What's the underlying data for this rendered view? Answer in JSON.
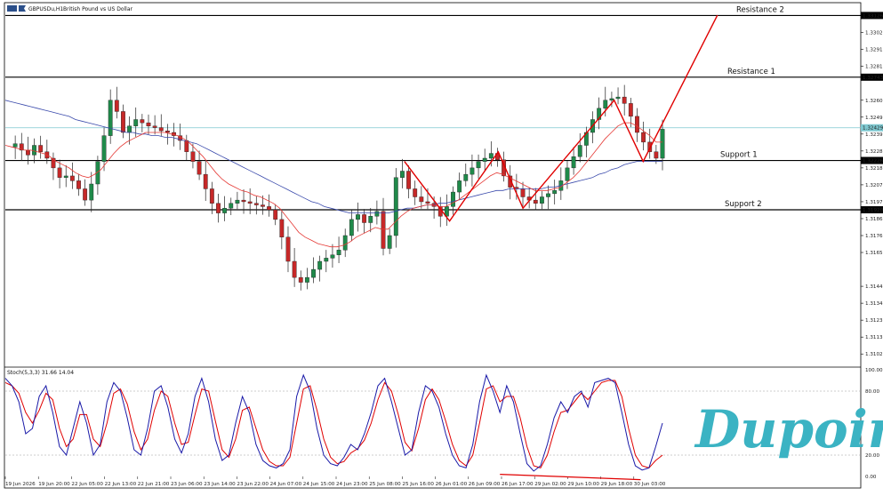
{
  "header": {
    "symbol": "GBPUSDu,H1",
    "description": "British Pound vs US Dollar",
    "icons": [
      "chart-menu-icon",
      "favorite-flag-icon"
    ]
  },
  "colors": {
    "bull": "#2e8b57",
    "bear": "#b22222",
    "ma_fast": "#e53935",
    "ma_slow": "#3949ab",
    "stoch_main": "#1a1aa8",
    "stoch_signal": "#e00000",
    "annotation": "#e00000",
    "current_price_line": "#7ec8d0",
    "logo": "#3bb3c3"
  },
  "levels": [
    {
      "name": "Resistance 2",
      "price": 1.33126,
      "tag": "1.33126"
    },
    {
      "name": "Resistance 1",
      "price": 1.32743,
      "tag": "1.32743"
    },
    {
      "name": "Support 1",
      "price": 1.32226,
      "tag": "1.32226"
    },
    {
      "name": "Support 2",
      "price": 1.3192,
      "tag": "1.31920"
    }
  ],
  "current_price": {
    "price": 1.32429,
    "tag": "1.32429"
  },
  "chart_data": {
    "type": "candlestick",
    "price_axis": {
      "ylim": [
        1.3096,
        1.332
      ],
      "ticks": [
        "1.33020",
        "1.32915",
        "1.32810",
        "1.32600",
        "1.32495",
        "1.32390",
        "1.32285",
        "1.32180",
        "1.32075",
        "1.31970",
        "1.31865",
        "1.31760",
        "1.31655",
        "1.31445",
        "1.31340",
        "1.31235",
        "1.31130",
        "1.31025"
      ]
    },
    "time_axis": {
      "labels": [
        "19 Jun 2026",
        "19 Jun 20:00",
        "22 Jun 05:00",
        "22 Jun 13:00",
        "22 Jun 21:00",
        "23 Jun 06:00",
        "23 Jun 14:00",
        "23 Jun 22:00",
        "24 Jun 07:00",
        "24 Jun 15:00",
        "24 Jun 23:00",
        "25 Jun 08:00",
        "25 Jun 16:00",
        "26 Jun 01:00",
        "26 Jun 09:00",
        "26 Jun 17:00",
        "29 Jun 02:00",
        "29 Jun 10:00",
        "29 Jun 18:00",
        "30 Jun 03:00"
      ]
    },
    "close_path": [
      1.3231,
      1.3233,
      1.3229,
      1.3226,
      1.3232,
      1.3228,
      1.3224,
      1.3218,
      1.3212,
      1.3213,
      1.321,
      1.3205,
      1.3198,
      1.3208,
      1.3222,
      1.3238,
      1.326,
      1.3253,
      1.324,
      1.3244,
      1.3248,
      1.3246,
      1.3244,
      1.3243,
      1.3241,
      1.324,
      1.3238,
      1.3235,
      1.3228,
      1.3222,
      1.3214,
      1.3205,
      1.3196,
      1.319,
      1.3193,
      1.3196,
      1.3198,
      1.3197,
      1.3196,
      1.3195,
      1.3194,
      1.3192,
      1.3186,
      1.3175,
      1.316,
      1.315,
      1.3147,
      1.315,
      1.3155,
      1.316,
      1.3162,
      1.3164,
      1.3167,
      1.3176,
      1.3186,
      1.3189,
      1.3184,
      1.3188,
      1.3191,
      1.3168,
      1.3176,
      1.3212,
      1.3216,
      1.3205,
      1.32,
      1.3197,
      1.3196,
      1.3194,
      1.3188,
      1.3194,
      1.3203,
      1.321,
      1.3214,
      1.3218,
      1.3222,
      1.3224,
      1.3227,
      1.3223,
      1.3213,
      1.3206,
      1.3205,
      1.32,
      1.3198,
      1.3196,
      1.32,
      1.3202,
      1.3204,
      1.321,
      1.3218,
      1.3225,
      1.3232,
      1.324,
      1.3248,
      1.3255,
      1.326,
      1.3261,
      1.3262,
      1.3258,
      1.325,
      1.324,
      1.3234,
      1.3228,
      1.3224,
      1.3242
    ],
    "ma_fast_path": [
      1.3232,
      1.3231,
      1.323,
      1.3229,
      1.3229,
      1.3228,
      1.3227,
      1.3225,
      1.3222,
      1.322,
      1.3218,
      1.3215,
      1.3213,
      1.3212,
      1.3214,
      1.3217,
      1.3222,
      1.3227,
      1.3231,
      1.3234,
      1.3236,
      1.3238,
      1.324,
      1.324,
      1.324,
      1.324,
      1.3239,
      1.3238,
      1.3236,
      1.3233,
      1.3229,
      1.3225,
      1.322,
      1.3215,
      1.3211,
      1.3208,
      1.3206,
      1.3204,
      1.3203,
      1.3201,
      1.32,
      1.3198,
      1.3196,
      1.3193,
      1.3188,
      1.3183,
      1.3178,
      1.3175,
      1.3173,
      1.3171,
      1.317,
      1.3169,
      1.3169,
      1.317,
      1.3172,
      1.3175,
      1.3177,
      1.3179,
      1.3181,
      1.318,
      1.318,
      1.3184,
      1.3188,
      1.3191,
      1.3193,
      1.3194,
      1.3195,
      1.3195,
      1.3194,
      1.3194,
      1.3196,
      1.3198,
      1.3201,
      1.3204,
      1.3207,
      1.321,
      1.3213,
      1.3215,
      1.3214,
      1.3212,
      1.321,
      1.3208,
      1.3206,
      1.3204,
      1.3204,
      1.3204,
      1.3205,
      1.3206,
      1.3209,
      1.3212,
      1.3216,
      1.3221,
      1.3226,
      1.3231,
      1.3236,
      1.324,
      1.3244,
      1.3246,
      1.3246,
      1.3244,
      1.3241,
      1.3238,
      1.3234,
      1.3234
    ],
    "ma_slow_path": [
      1.326,
      1.3259,
      1.3258,
      1.3257,
      1.3256,
      1.3255,
      1.3254,
      1.3253,
      1.3252,
      1.3251,
      1.325,
      1.3248,
      1.3247,
      1.3246,
      1.3245,
      1.3244,
      1.3243,
      1.3242,
      1.3241,
      1.324,
      1.324,
      1.3239,
      1.3239,
      1.3238,
      1.3238,
      1.3237,
      1.3237,
      1.3236,
      1.3235,
      1.3234,
      1.3233,
      1.3231,
      1.3229,
      1.3227,
      1.3225,
      1.3223,
      1.3221,
      1.3219,
      1.3217,
      1.3215,
      1.3213,
      1.3211,
      1.3209,
      1.3207,
      1.3205,
      1.3203,
      1.3201,
      1.3199,
      1.3197,
      1.3196,
      1.3194,
      1.3193,
      1.3192,
      1.3191,
      1.319,
      1.319,
      1.319,
      1.319,
      1.319,
      1.319,
      1.319,
      1.3191,
      1.3192,
      1.3193,
      1.3193,
      1.3194,
      1.3195,
      1.3195,
      1.3196,
      1.3196,
      1.3197,
      1.3198,
      1.3199,
      1.32,
      1.3201,
      1.3202,
      1.3203,
      1.3204,
      1.3204,
      1.3205,
      1.3205,
      1.3205,
      1.3205,
      1.3205,
      1.3205,
      1.3206,
      1.3206,
      1.3207,
      1.3208,
      1.3209,
      1.321,
      1.3211,
      1.3212,
      1.3214,
      1.3215,
      1.3217,
      1.3218,
      1.322,
      1.3221,
      1.3222,
      1.3222,
      1.3222,
      1.3222,
      1.3222
    ]
  },
  "stochastic": {
    "label": "Stoch(5,3,3) 31.66 14.04",
    "ylim": [
      0,
      100
    ],
    "levels": [
      80,
      20
    ],
    "ticks": [
      "100.00",
      "80.00",
      "20.00",
      "0.00"
    ],
    "main_path": [
      92,
      85,
      70,
      40,
      45,
      75,
      85,
      60,
      28,
      20,
      45,
      70,
      50,
      20,
      30,
      70,
      88,
      80,
      55,
      25,
      20,
      45,
      80,
      85,
      65,
      35,
      22,
      40,
      75,
      92,
      70,
      35,
      15,
      20,
      50,
      75,
      60,
      30,
      15,
      10,
      8,
      12,
      25,
      75,
      95,
      80,
      45,
      20,
      12,
      10,
      18,
      30,
      25,
      40,
      60,
      85,
      92,
      70,
      45,
      20,
      25,
      60,
      85,
      80,
      65,
      40,
      20,
      10,
      8,
      30,
      70,
      95,
      80,
      60,
      85,
      70,
      40,
      12,
      5,
      10,
      30,
      55,
      70,
      60,
      75,
      80,
      65,
      88,
      90,
      92,
      88,
      60,
      30,
      10,
      6,
      8,
      28,
      50
    ],
    "signal_path": [
      88,
      85,
      78,
      60,
      50,
      62,
      78,
      72,
      45,
      28,
      35,
      58,
      58,
      35,
      28,
      50,
      78,
      82,
      68,
      42,
      25,
      35,
      62,
      80,
      75,
      50,
      30,
      32,
      58,
      82,
      80,
      52,
      25,
      18,
      35,
      62,
      65,
      45,
      25,
      14,
      10,
      10,
      18,
      50,
      82,
      85,
      62,
      35,
      18,
      12,
      14,
      22,
      26,
      34,
      50,
      72,
      88,
      80,
      58,
      32,
      24,
      45,
      72,
      82,
      72,
      52,
      30,
      15,
      10,
      20,
      50,
      82,
      85,
      70,
      75,
      75,
      55,
      28,
      10,
      8,
      20,
      42,
      60,
      62,
      70,
      78,
      72,
      80,
      88,
      90,
      90,
      75,
      45,
      20,
      10,
      8,
      15,
      20
    ]
  },
  "annotations": {
    "zigzag": [
      {
        "t": 0.468,
        "p": 1.3222
      },
      {
        "t": 0.521,
        "p": 1.3185
      },
      {
        "t": 0.578,
        "p": 1.3228
      },
      {
        "t": 0.607,
        "p": 1.3193
      },
      {
        "t": 0.714,
        "p": 1.326
      },
      {
        "t": 0.748,
        "p": 1.3222
      },
      {
        "t": 0.835,
        "p": 1.33128
      }
    ],
    "stoch_divergence": {
      "from": {
        "t": 0.58,
        "v": 2
      },
      "to": {
        "t": 0.745,
        "v": -3
      }
    }
  },
  "logo": {
    "text": "Dupoin"
  }
}
